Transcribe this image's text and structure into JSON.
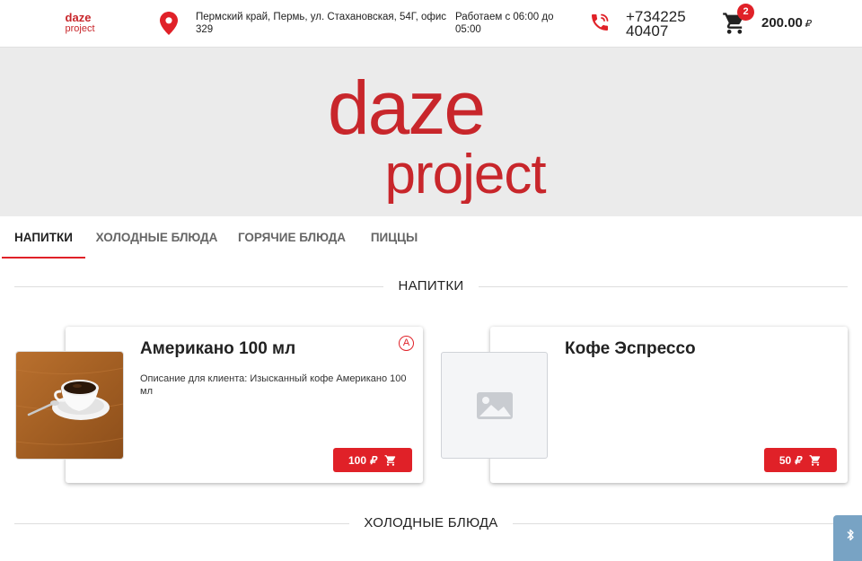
{
  "header": {
    "address": "Пермский край, Пермь, ул. Стахановская, 54Г, офис 329",
    "hours": "Работаем с 06:00 до 05:00",
    "phone": "+73422540407",
    "cart_count": "2",
    "cart_total": "200.00",
    "currency": "₽"
  },
  "logo": {
    "line1": "daze",
    "line2": "project"
  },
  "tabs": [
    {
      "label": "НАПИТКИ",
      "active": true
    },
    {
      "label": "ХОЛОДНЫЕ БЛЮДА",
      "active": false
    },
    {
      "label": "ГОРЯЧИЕ БЛЮДА",
      "active": false
    },
    {
      "label": "ПИЦЦЫ",
      "active": false
    }
  ],
  "sections": [
    {
      "title": "НАПИТКИ"
    },
    {
      "title": "ХОЛОДНЫЕ БЛЮДА"
    }
  ],
  "products": [
    {
      "name": "Американо 100 мл",
      "description": "Описание для клиента: Изысканный кофе Американо 100 мл",
      "badge": "А",
      "price": "100",
      "currency": "₽",
      "image": "coffee-cup-photo"
    },
    {
      "name": "Кофе Эспрессо",
      "description": "",
      "price": "50",
      "currency": "₽",
      "image": "image-placeholder-icon"
    }
  ],
  "colors": {
    "accent": "#e02128",
    "banner_bg": "#ebebeb",
    "widget": "#78a3c4"
  }
}
